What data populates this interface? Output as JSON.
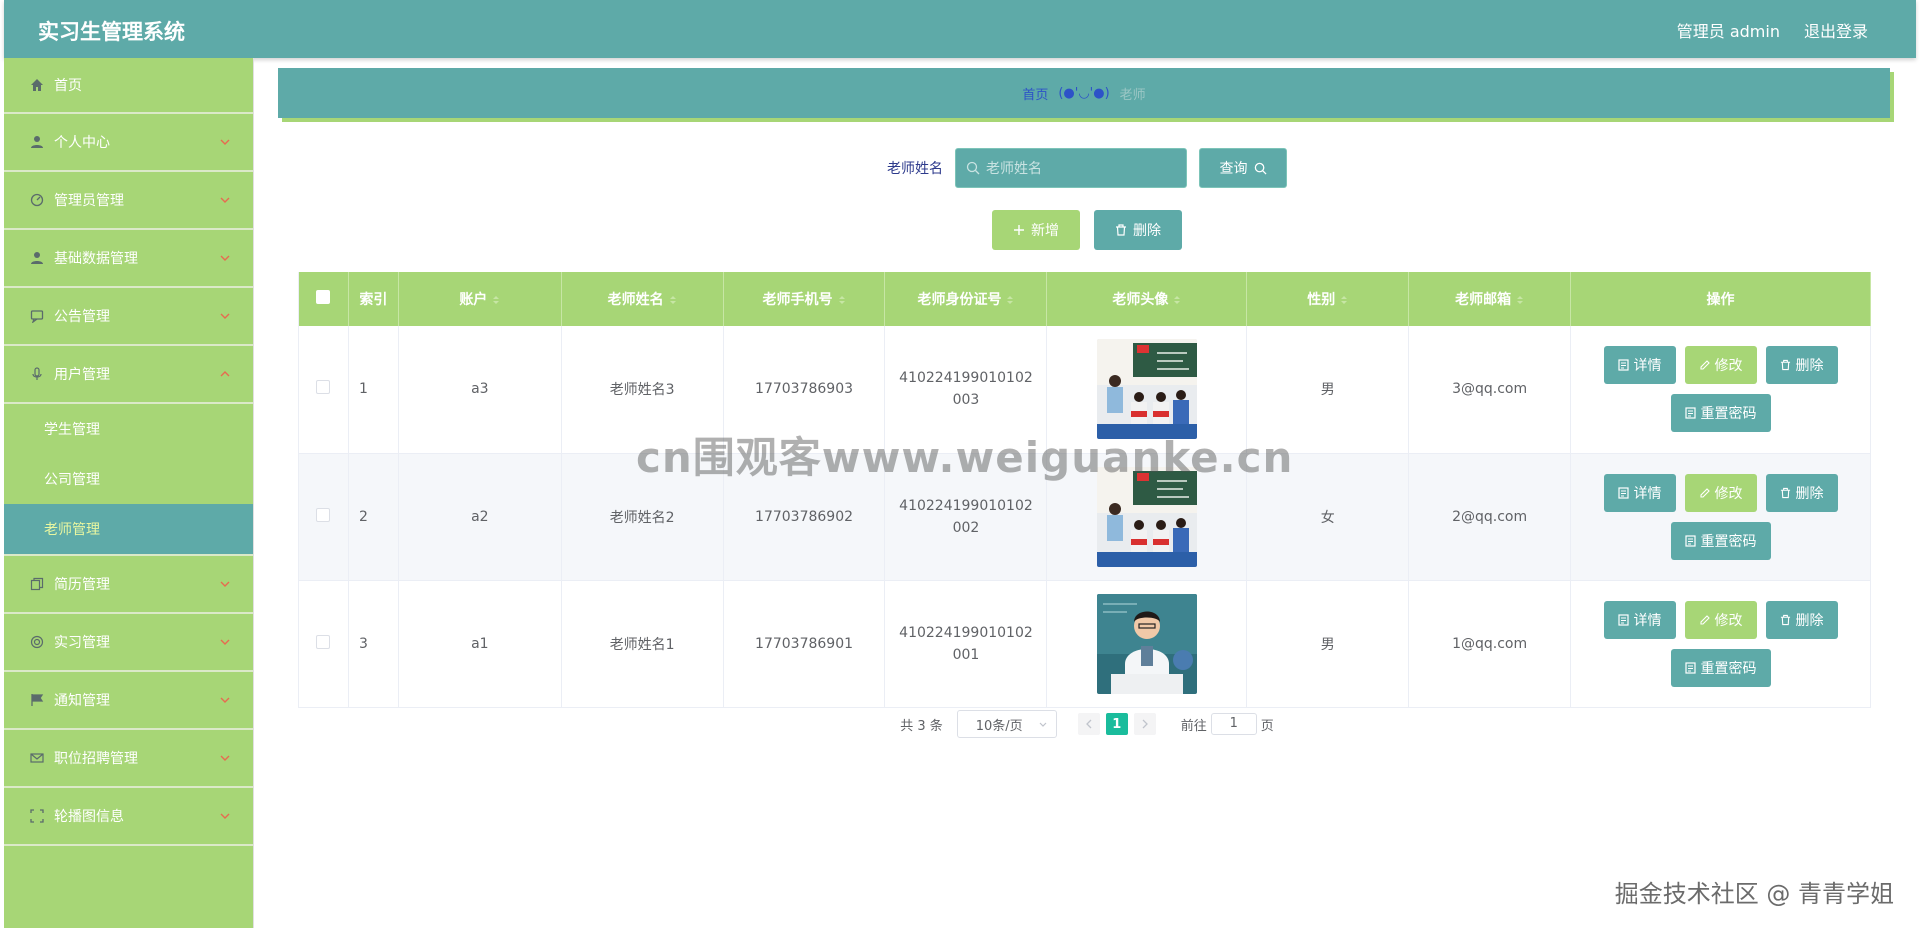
{
  "header": {
    "title": "实习生管理系统",
    "user": "管理员 admin",
    "logout": "退出登录"
  },
  "sidebar": {
    "items": [
      {
        "label": "首页",
        "icon": "home-icon"
      },
      {
        "label": "个人中心",
        "icon": "user-icon"
      },
      {
        "label": "管理员管理",
        "icon": "gauge-icon"
      },
      {
        "label": "基础数据管理",
        "icon": "user-icon"
      },
      {
        "label": "公告管理",
        "icon": "chat-icon"
      },
      {
        "label": "用户管理",
        "icon": "mic-icon"
      },
      {
        "label": "简历管理",
        "icon": "copy-icon"
      },
      {
        "label": "实习管理",
        "icon": "target-icon"
      },
      {
        "label": "通知管理",
        "icon": "flag-icon"
      },
      {
        "label": "职位招聘管理",
        "icon": "mail-icon"
      },
      {
        "label": "轮播图信息",
        "icon": "fullscreen-icon"
      }
    ],
    "sub_items": [
      "学生管理",
      "公司管理",
      "老师管理"
    ]
  },
  "breadcrumb": {
    "home": "首页",
    "separator": "(●'◡'●)",
    "current": "老师"
  },
  "search": {
    "label": "老师姓名",
    "placeholder": "老师姓名",
    "button": "查询"
  },
  "actions": {
    "add": "新增",
    "delete": "删除"
  },
  "table": {
    "headers": [
      "索引",
      "账户",
      "老师姓名",
      "老师手机号",
      "老师身份证号",
      "老师头像",
      "性别",
      "老师邮箱",
      "操作"
    ],
    "rows": [
      {
        "index": "1",
        "account": "a3",
        "name": "老师姓名3",
        "phone": "17703786903",
        "idcard": "410224199010102003",
        "gender": "男",
        "email": "3@qq.com"
      },
      {
        "index": "2",
        "account": "a2",
        "name": "老师姓名2",
        "phone": "17703786902",
        "idcard": "410224199010102002",
        "gender": "女",
        "email": "2@qq.com"
      },
      {
        "index": "3",
        "account": "a1",
        "name": "老师姓名1",
        "phone": "17703786901",
        "idcard": "410224199010102001",
        "gender": "男",
        "email": "1@qq.com"
      }
    ],
    "ops": {
      "detail": "详情",
      "edit": "修改",
      "delete": "删除",
      "reset": "重置密码"
    }
  },
  "pagination": {
    "total": "共 3 条",
    "page_size": "10条/页",
    "current": "1",
    "goto_label": "前往",
    "goto_value": "1",
    "page_unit": "页"
  },
  "watermark": "cn围观客www.weiguanke.cn",
  "footer_mark": "掘金技术社区 @ 青青学姐",
  "colors": {
    "teal": "#5eaaa8",
    "green": "#a7d676",
    "active_page": "#1abc9c"
  }
}
